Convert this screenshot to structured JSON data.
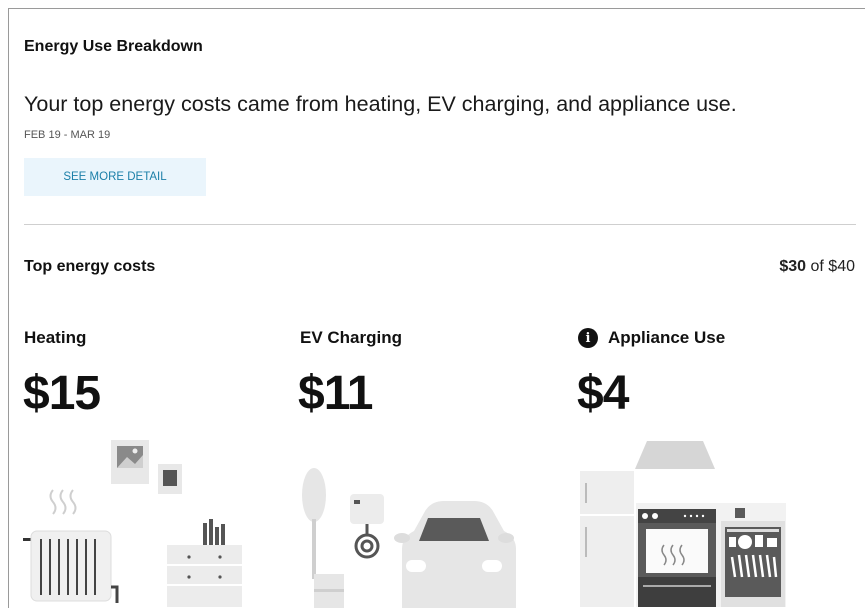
{
  "card": {
    "title": "Energy Use Breakdown",
    "summary": "Your top energy costs came from heating, EV charging, and appliance use.",
    "date_range": "FEB 19 - MAR 19",
    "detail_button_label": "SEE MORE DETAIL"
  },
  "top_costs": {
    "title": "Top energy costs",
    "total_used": "$30",
    "total_of": "of $40"
  },
  "categories": [
    {
      "label": "Heating",
      "amount": "$15",
      "icon": "radiator-room-illustration"
    },
    {
      "label": "EV Charging",
      "amount": "$11",
      "icon": "ev-car-charger-illustration"
    },
    {
      "label": "Appliance Use",
      "amount": "$4",
      "icon": "kitchen-appliances-illustration",
      "info_icon": "info-icon",
      "info_glyph": "i"
    }
  ],
  "colors": {
    "button_bg": "#eaf5fc",
    "button_text": "#1b7fa8",
    "illustration_light": "#e6e6e6",
    "illustration_dark": "#5a5a5a"
  }
}
